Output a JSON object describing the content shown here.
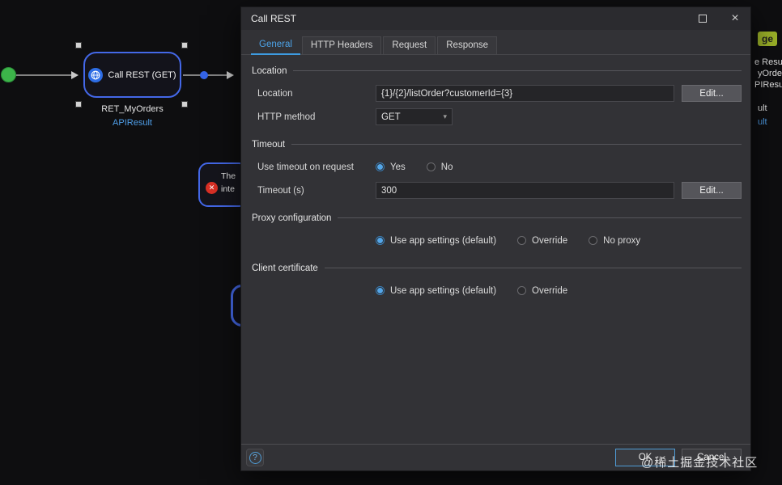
{
  "colors": {
    "accent_blue": "#4f9cd6",
    "node_border_blue": "#4468e8",
    "start_green": "#3cb44a",
    "error_red": "#d93025",
    "badge_green": "#9ab028",
    "link_blue": "#4f9ee8"
  },
  "icons": {
    "close": "×",
    "dropdown_arrow": "▾",
    "help": "?",
    "error": "✕"
  },
  "watermark": "@稀土掘金技术社区",
  "canvas": {
    "call_rest_node": {
      "label": "Call REST (GET)",
      "caption": "RET_MyOrders",
      "variable": "APIResult"
    },
    "error_node": {
      "line1": "The",
      "line2": "inte"
    },
    "right_edge": {
      "badge": "ge",
      "frag1": "e Resu",
      "frag2": "yOrde",
      "frag3": "PIResu",
      "frag4": "ult",
      "frag5": "ult"
    }
  },
  "dialog": {
    "title": "Call REST",
    "tabs": [
      {
        "label": "General"
      },
      {
        "label": "HTTP Headers"
      },
      {
        "label": "Request"
      },
      {
        "label": "Response"
      }
    ],
    "location_group": {
      "title": "Location",
      "location_label": "Location",
      "location_value": "{1}/{2}/listOrder?customerId={3}",
      "edit_button": "Edit...",
      "http_method_label": "HTTP method",
      "http_method_value": "GET"
    },
    "timeout_group": {
      "title": "Timeout",
      "use_timeout_label": "Use timeout on request",
      "yes_label": "Yes",
      "no_label": "No",
      "timeout_label": "Timeout (s)",
      "timeout_value": "300",
      "edit_button": "Edit..."
    },
    "proxy_group": {
      "title": "Proxy configuration",
      "option_default": "Use app settings (default)",
      "option_override": "Override",
      "option_noproxy": "No proxy"
    },
    "cert_group": {
      "title": "Client certificate",
      "option_default": "Use app settings (default)",
      "option_override": "Override"
    },
    "footer": {
      "ok": "OK",
      "cancel": "Cancel"
    }
  }
}
